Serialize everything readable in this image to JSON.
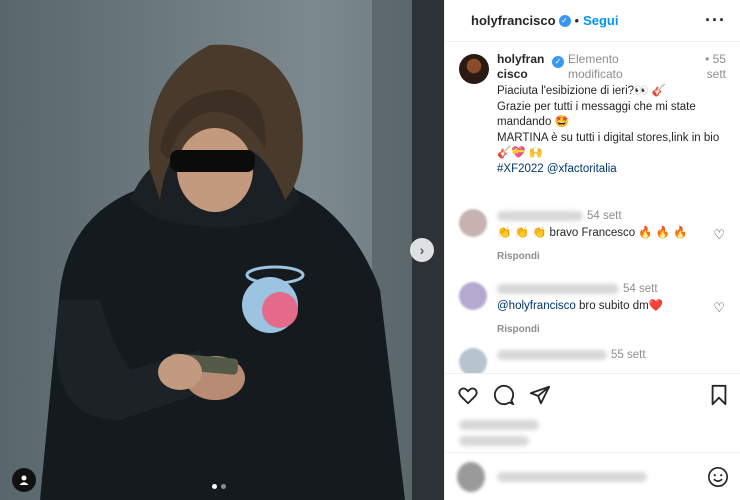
{
  "header": {
    "username": "holyfrancisco",
    "separator": "•",
    "follow_label": "Segui",
    "more_icon": "more-horizontal-icon"
  },
  "caption": {
    "username": "holyfrancisco",
    "meta": "Elemento modificato",
    "time": "• 55 sett",
    "line1": "Piaciuta l'esibizione di ieri?👀 🎸",
    "line2": "Grazie per tutti i messaggi che mi state mandando 🤩",
    "line3": "MARTINA è su tutti i digital stores,link in bio🎸💝 🙌",
    "hashtags": "#XF2022 @xfactoritalia"
  },
  "comments": [
    {
      "time": "54 sett",
      "text": "👏 👏 👏 bravo Francesco 🔥 🔥 🔥",
      "reply": "Rispondi"
    },
    {
      "time": "54 sett",
      "mention": "@holyfrancisco",
      "text": " bro subito dm❤️",
      "reply": "Rispondi"
    },
    {
      "time": "55 sett"
    }
  ],
  "icons": [
    "heart-icon",
    "comment-icon",
    "share-icon",
    "save-icon",
    "smiley-icon",
    "chevron-right-icon",
    "user-tag-icon"
  ],
  "colors": {
    "accent": "#0095f6",
    "verified": "#3897f0",
    "link": "#00376b",
    "muted": "#8e8e8e"
  },
  "carousel": {
    "slide_count": 2,
    "active_index": 0
  }
}
